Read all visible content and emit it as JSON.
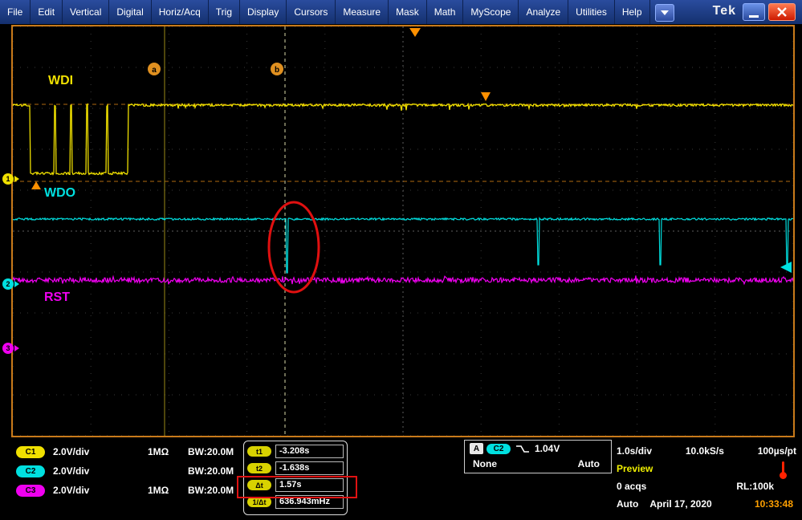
{
  "colors": {
    "ch1": "#f0e000",
    "ch2": "#00e0e0",
    "ch3": "#f000f0",
    "accent_orange": "#ff9000",
    "annotation_red": "#e01010",
    "menu_bg": "#1c3a80",
    "time_orange": "#ffa000"
  },
  "menu": {
    "items": [
      "File",
      "Edit",
      "Vertical",
      "Digital",
      "Horiz/Acq",
      "Trig",
      "Display",
      "Cursors",
      "Measure",
      "Mask",
      "Math",
      "MyScope",
      "Analyze",
      "Utilities",
      "Help"
    ],
    "brand": "Tek"
  },
  "plot": {
    "labels": {
      "ch1": "WDI",
      "ch2": "WDO",
      "ch3": "RST"
    },
    "markers": {
      "a": "a",
      "b": "b"
    },
    "channel_numbers": [
      "1",
      "2",
      "3"
    ]
  },
  "channels": [
    {
      "id": "C1",
      "scale": "2.0V/div",
      "impedance": "1MΩ",
      "bw": "BW:20.0M"
    },
    {
      "id": "C2",
      "scale": "2.0V/div",
      "impedance": "",
      "bw": "BW:20.0M"
    },
    {
      "id": "C3",
      "scale": "2.0V/div",
      "impedance": "1MΩ",
      "bw": "BW:20.0M"
    }
  ],
  "cursors": {
    "t1_label": "t1",
    "t1": "-3.208s",
    "t2_label": "t2",
    "t2": "-1.638s",
    "dt_label": "Δt",
    "dt": "1.57s",
    "inv_label": "1/Δt",
    "inv": "636.943mHz"
  },
  "trigger": {
    "system": "A",
    "source": "C2",
    "level": "1.04V",
    "type": "None",
    "mode": "Auto"
  },
  "horizontal": {
    "scale": "1.0s/div",
    "sample_rate": "10.0kS/s",
    "resolution": "100µs/pt",
    "state": "Preview",
    "acquisitions": "0 acqs",
    "record_length": "RL:100k",
    "trig_mode": "Auto",
    "date": "April 17, 2020",
    "time": "10:33:48"
  }
}
